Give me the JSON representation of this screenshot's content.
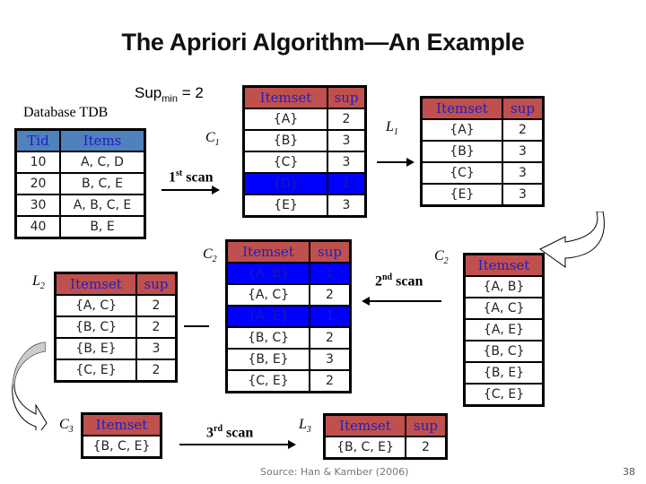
{
  "title": "The Apriori Algorithm—An Example",
  "sup_min": {
    "label": "Sup",
    "sub": "min",
    "value": "= 2"
  },
  "database": {
    "label": "Database TDB",
    "headers": [
      "Tid",
      "Items"
    ],
    "rows": [
      [
        "10",
        "A, C, D"
      ],
      [
        "20",
        "B, C, E"
      ],
      [
        "30",
        "A, B, C, E"
      ],
      [
        "40",
        "B, E"
      ]
    ]
  },
  "labels": {
    "c1": {
      "main": "C",
      "sub": "1"
    },
    "l1": {
      "main": "L",
      "sub": "1"
    },
    "c2_left": {
      "main": "C",
      "sub": "2"
    },
    "c2_right": {
      "main": "C",
      "sub": "2"
    },
    "l2": {
      "main": "L",
      "sub": "2"
    },
    "c3": {
      "main": "C",
      "sub": "3"
    },
    "l3": {
      "main": "L",
      "sub": "3"
    }
  },
  "scans": {
    "first": {
      "num": "1",
      "sup": "st",
      "word": "scan"
    },
    "second": {
      "num": "2",
      "sup": "nd",
      "word": "scan"
    },
    "third": {
      "num": "3",
      "sup": "rd",
      "word": "scan"
    }
  },
  "headers": {
    "itemset": "Itemset",
    "sup": "sup"
  },
  "c1_table": {
    "rows": [
      {
        "itemset": "{A}",
        "sup": "2",
        "pruned": false
      },
      {
        "itemset": "{B}",
        "sup": "3",
        "pruned": false
      },
      {
        "itemset": "{C}",
        "sup": "3",
        "pruned": false
      },
      {
        "itemset": "{D}",
        "sup": "1",
        "pruned": true
      },
      {
        "itemset": "{E}",
        "sup": "3",
        "pruned": false
      }
    ]
  },
  "l1_table": {
    "rows": [
      {
        "itemset": "{A}",
        "sup": "2"
      },
      {
        "itemset": "{B}",
        "sup": "3"
      },
      {
        "itemset": "{C}",
        "sup": "3"
      },
      {
        "itemset": "{E}",
        "sup": "3"
      }
    ]
  },
  "c2_count_table": {
    "rows": [
      {
        "itemset": "{A, B}",
        "sup": "1",
        "pruned": true
      },
      {
        "itemset": "{A, C}",
        "sup": "2",
        "pruned": false
      },
      {
        "itemset": "{A, E}",
        "sup": "1",
        "pruned": true
      },
      {
        "itemset": "{B, C}",
        "sup": "2",
        "pruned": false
      },
      {
        "itemset": "{B, E}",
        "sup": "3",
        "pruned": false
      },
      {
        "itemset": "{C, E}",
        "sup": "2",
        "pruned": false
      }
    ]
  },
  "c2_candidates_table": {
    "rows": [
      "{A, B}",
      "{A, C}",
      "{A, E}",
      "{B, C}",
      "{B, E}",
      "{C, E}"
    ]
  },
  "l2_table": {
    "rows": [
      {
        "itemset": "{A, C}",
        "sup": "2"
      },
      {
        "itemset": "{B, C}",
        "sup": "2"
      },
      {
        "itemset": "{B, E}",
        "sup": "3"
      },
      {
        "itemset": "{C, E}",
        "sup": "2"
      }
    ]
  },
  "c3_table": {
    "rows": [
      "{B, C, E}"
    ]
  },
  "l3_table": {
    "rows": [
      {
        "itemset": "{B, C, E}",
        "sup": "2"
      }
    ]
  },
  "footer": {
    "source": "Source: Han & Kamber (2006)",
    "page": "38"
  },
  "colors": {
    "header_red": "#c0504d",
    "header_blue": "#4f81bd",
    "pruned_blue": "#0000ff",
    "header_text": "#1f1fbf"
  }
}
